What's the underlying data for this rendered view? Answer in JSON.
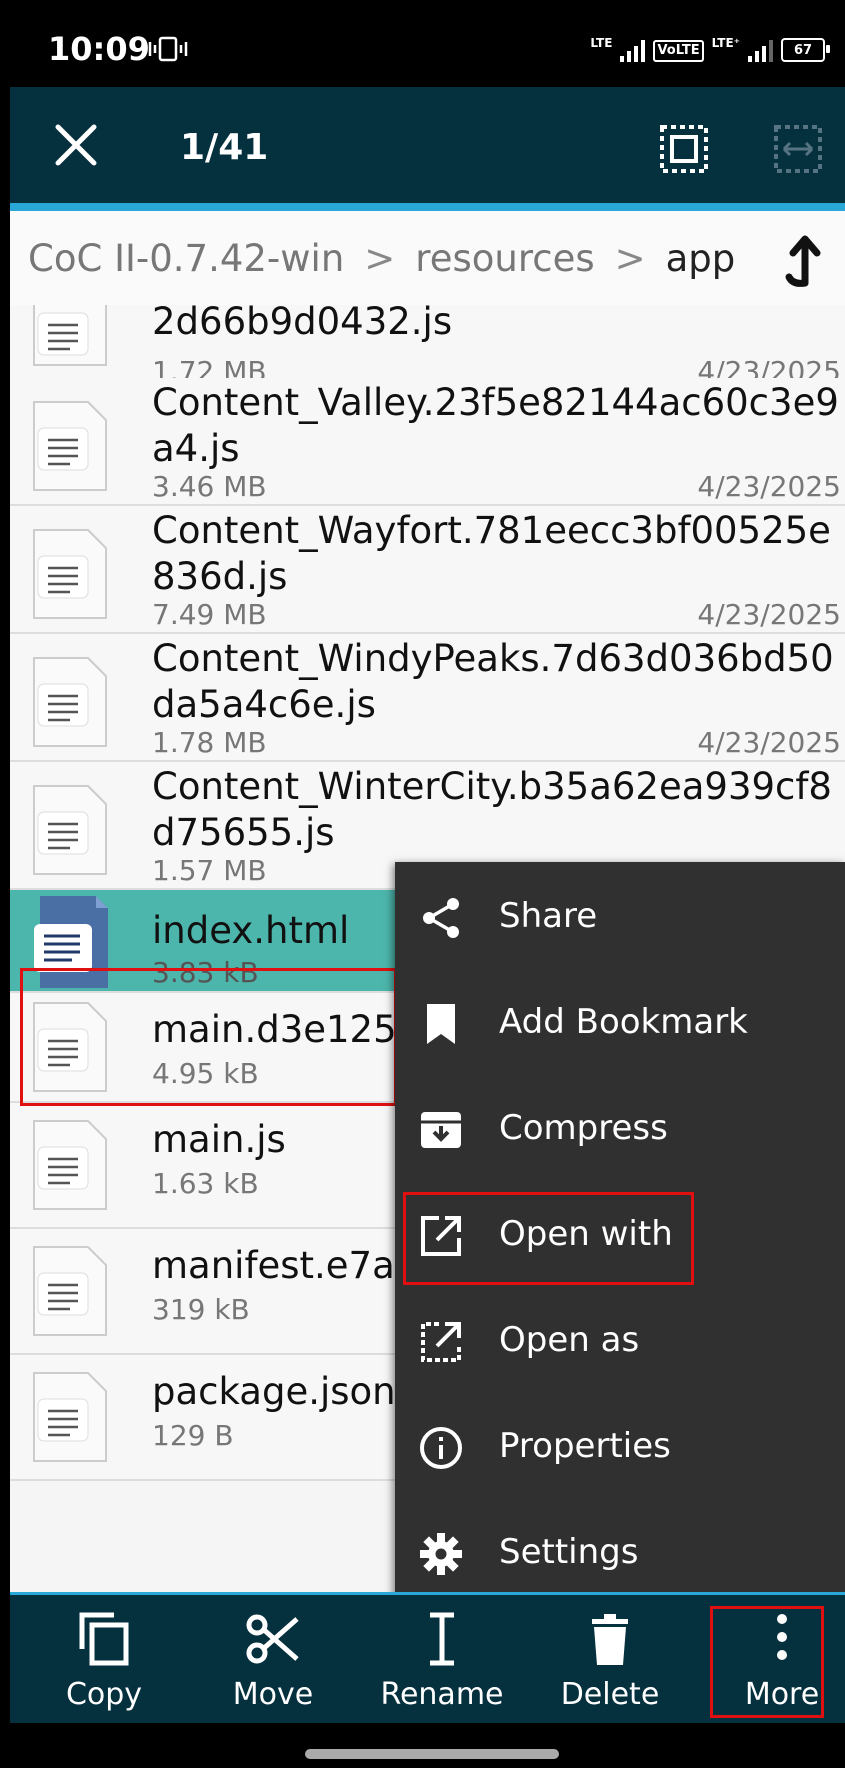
{
  "status": {
    "time": "10:09",
    "lte1": "LTE",
    "volte": "VoLTE",
    "lte2": "LTE⁺",
    "battery": "67"
  },
  "appbar": {
    "count": "1/41"
  },
  "breadcrumb": {
    "items": [
      "CoC II-0.7.42-win",
      "resources",
      "app"
    ]
  },
  "files": [
    {
      "name": "2d66b9d0432.js",
      "size": "1.72 MB",
      "date": "4/23/2025"
    },
    {
      "name": "Content_Valley.23f5e82144ac60c3e9a4.js",
      "size": "3.46 MB",
      "date": "4/23/2025"
    },
    {
      "name": "Content_Wayfort.781eecc3bf00525e836d.js",
      "size": "7.49 MB",
      "date": "4/23/2025"
    },
    {
      "name": "Content_WindyPeaks.7d63d036bd50da5a4c6e.js",
      "size": "1.78 MB",
      "date": "4/23/2025"
    },
    {
      "name": "Content_WinterCity.b35a62ea939cf8d75655.js",
      "size": "1.57 MB",
      "date": ""
    },
    {
      "name": "index.html",
      "size": "3.83 kB",
      "date": "",
      "selected": true
    },
    {
      "name": "main.d3e125",
      "size": "4.95 kB",
      "date": ""
    },
    {
      "name": "main.js",
      "size": "1.63 kB",
      "date": ""
    },
    {
      "name": "manifest.e7a",
      "size": "319 kB",
      "date": ""
    },
    {
      "name": "package.json",
      "size": "129 B",
      "date": ""
    }
  ],
  "menu": {
    "items": [
      {
        "label": "Share",
        "icon": "share-icon"
      },
      {
        "label": "Add Bookmark",
        "icon": "bookmark-icon"
      },
      {
        "label": "Compress",
        "icon": "archive-icon"
      },
      {
        "label": "Open with",
        "icon": "open-external-icon"
      },
      {
        "label": "Open as",
        "icon": "open-as-icon"
      },
      {
        "label": "Properties",
        "icon": "info-icon"
      },
      {
        "label": "Settings",
        "icon": "gear-icon"
      }
    ]
  },
  "bottom": {
    "copy": "Copy",
    "move": "Move",
    "rename": "Rename",
    "delete": "Delete",
    "more": "More"
  },
  "colors": {
    "appbar": "#05303e",
    "accent": "#29a8d8",
    "selected_row": "#4db6ac",
    "menu_bg": "#303030",
    "highlight": "#e01010"
  }
}
